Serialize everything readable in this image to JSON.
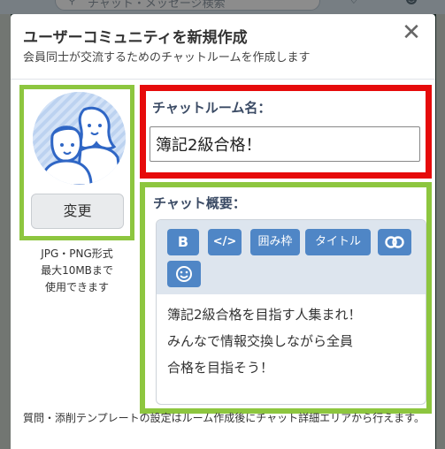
{
  "background": {
    "search_placeholder": "チャット・メッセージ検索"
  },
  "modal": {
    "title": "ユーザーコミュニティを新規作成",
    "subtitle": "会員同士が交流するためのチャットルームを作成します",
    "close_icon": "close-icon"
  },
  "avatar": {
    "change_label": "変更",
    "note_lines": [
      "JPG・PNG形式",
      "最大10MBまで",
      "使用できます"
    ]
  },
  "chat_name": {
    "label": "チャットルーム名：",
    "value": "簿記2級合格！"
  },
  "overview": {
    "label": "チャット概要：",
    "toolbar": {
      "bold": "B",
      "code": "</>",
      "box": "囲み枠",
      "title": "タイトル",
      "link_icon": "link-icon",
      "emoji_icon": "smile-icon"
    },
    "text_lines": [
      "簿記2級合格を目指す人集まれ！",
      "みんなで情報交換しながら全員",
      "合格を目指そう！"
    ]
  },
  "footer_note": "質問・添削テンプレートの設定はルーム作成後にチャット詳細エリアから行えます。",
  "colors": {
    "highlight_green": "#8dc63f",
    "highlight_red": "#e60b0b",
    "toolbar_button": "#4f86c6"
  }
}
